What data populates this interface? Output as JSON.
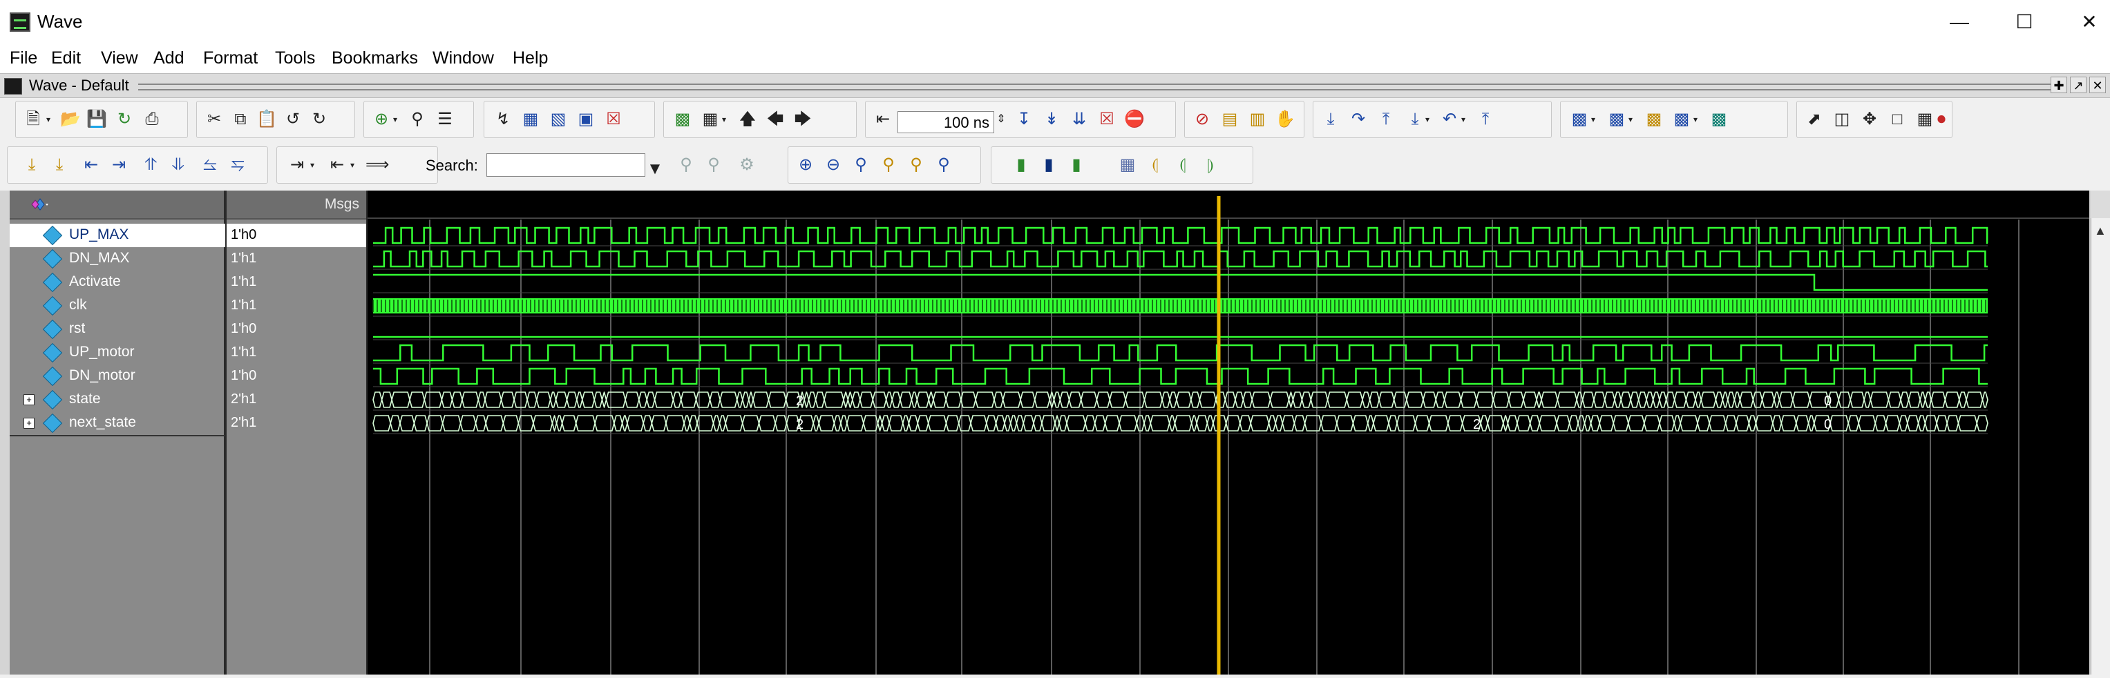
{
  "window": {
    "title": "Wave",
    "controls": [
      "minimize",
      "maximize",
      "close"
    ]
  },
  "menubar": {
    "items": [
      "File",
      "Edit",
      "View",
      "Add",
      "Format",
      "Tools",
      "Bookmarks",
      "Window",
      "Help"
    ]
  },
  "pane": {
    "title": "Wave - Default"
  },
  "toolbar": {
    "time_step_value": "100 ns",
    "search_label": "Search:",
    "search_value": ""
  },
  "wave": {
    "msgs_header": "Msgs",
    "signals": [
      {
        "name": "UP_MAX",
        "value": "1'h0",
        "selected": true,
        "expandable": false
      },
      {
        "name": "DN_MAX",
        "value": "1'h1",
        "selected": false,
        "expandable": false
      },
      {
        "name": "Activate",
        "value": "1'h1",
        "selected": false,
        "expandable": false
      },
      {
        "name": "clk",
        "value": "1'h1",
        "selected": false,
        "expandable": false
      },
      {
        "name": "rst",
        "value": "1'h0",
        "selected": false,
        "expandable": false
      },
      {
        "name": "UP_motor",
        "value": "1'h1",
        "selected": false,
        "expandable": false
      },
      {
        "name": "DN_motor",
        "value": "1'h0",
        "selected": false,
        "expandable": false
      },
      {
        "name": "state",
        "value": "2'h1",
        "selected": false,
        "expandable": true
      },
      {
        "name": "next_state",
        "value": "2'h1",
        "selected": false,
        "expandable": true
      }
    ],
    "bus_labels": {
      "state": [
        "2",
        "0"
      ],
      "next_state": [
        "2",
        "2",
        "0"
      ]
    },
    "colors": {
      "background": "#000000",
      "waveform": "#33ff33",
      "cursor": "#e8b800",
      "grid": "#7a7a7a"
    }
  }
}
